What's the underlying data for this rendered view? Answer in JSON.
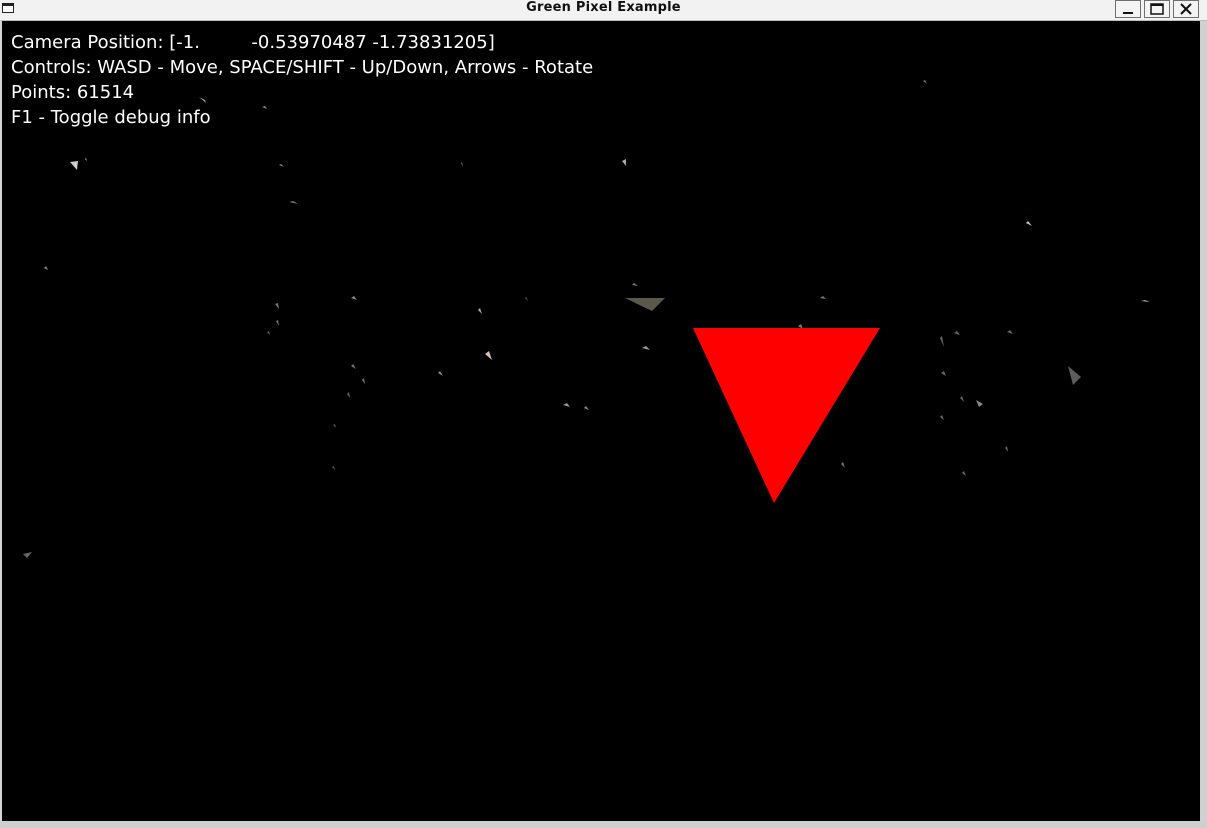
{
  "window": {
    "title": "Green Pixel Example"
  },
  "overlay": {
    "camera_position": "Camera Position: [-1.         -0.53970487 -1.73831205]",
    "controls": "Controls: WASD - Move, SPACE/SHIFT - Up/Down, Arrows - Rotate",
    "points": "Points: 61514",
    "debug_toggle": "F1 - Toggle debug info"
  },
  "colors": {
    "background": "#000000",
    "triangle": "#ff0000",
    "overlay_text": "#ffffff"
  },
  "icons": {
    "window_menu": "window-icon",
    "minimize": "minimize-icon",
    "maximize": "maximize-icon",
    "close": "close-icon"
  }
}
